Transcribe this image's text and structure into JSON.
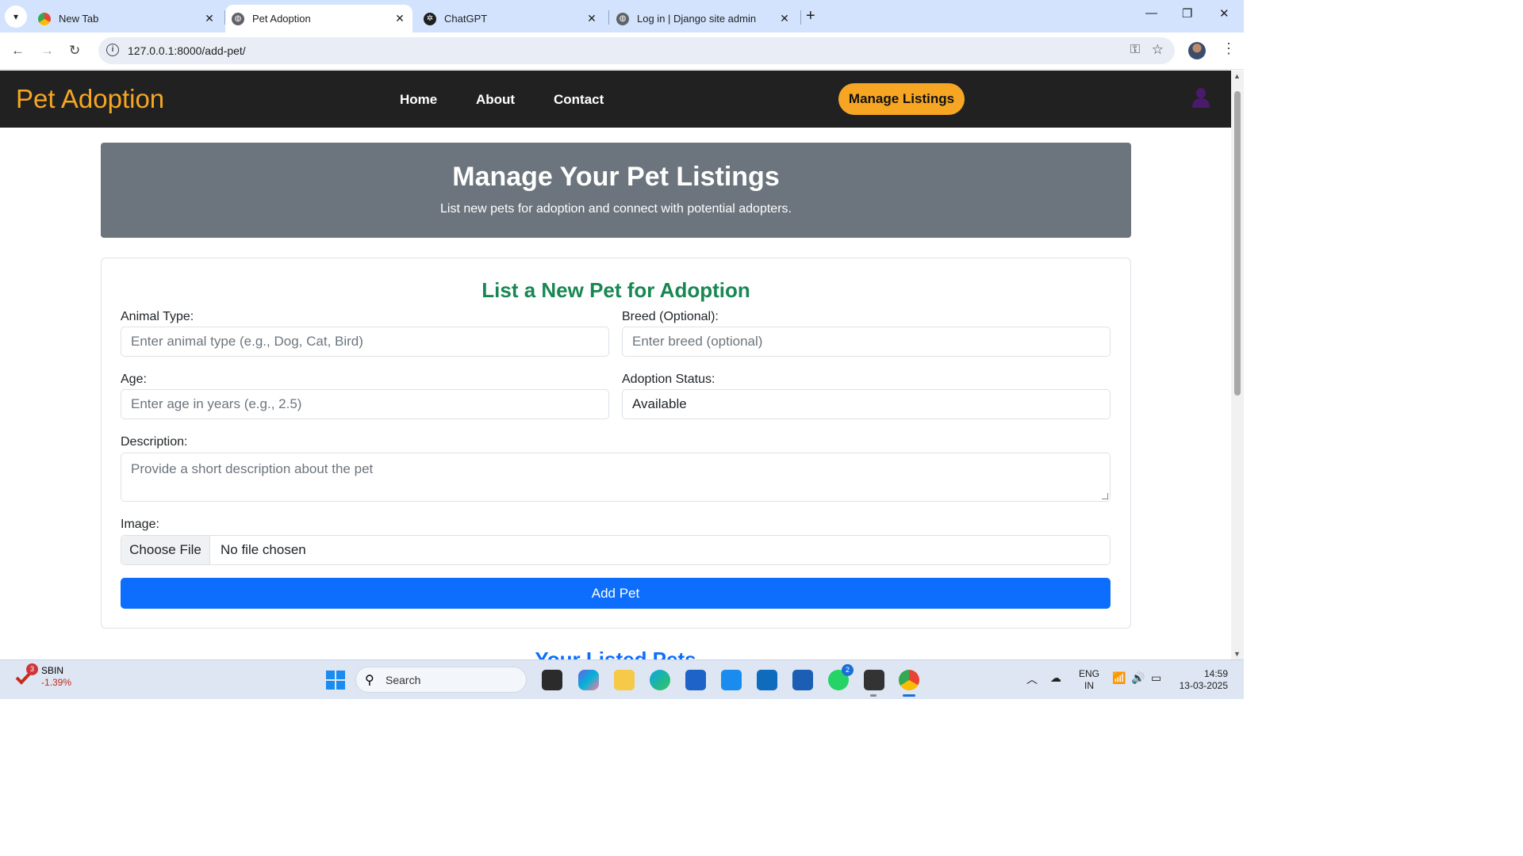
{
  "browser": {
    "tabs": [
      {
        "title": "New Tab",
        "icon": "chrome-icon",
        "active": false
      },
      {
        "title": "Pet Adoption",
        "icon": "globe-icon",
        "active": true
      },
      {
        "title": "ChatGPT",
        "icon": "chatgpt-icon",
        "active": false
      },
      {
        "title": "Log in | Django site admin",
        "icon": "globe-icon",
        "active": false
      }
    ],
    "url": "127.0.0.1:8000/add-pet/"
  },
  "site": {
    "brand": "Pet Adoption",
    "nav": {
      "home": "Home",
      "about": "About",
      "contact": "Contact"
    },
    "manage_button": "Manage Listings",
    "colors": {
      "brand": "#f5a623",
      "navbar": "#212121",
      "primary": "#0d6efd",
      "success": "#198754",
      "hero": "#6c757d"
    }
  },
  "hero": {
    "title": "Manage Your Pet Listings",
    "subtitle": "List new pets for adoption and connect with potential adopters."
  },
  "form": {
    "title": "List a New Pet for Adoption",
    "animal_type": {
      "label": "Animal Type:",
      "placeholder": "Enter animal type (e.g., Dog, Cat, Bird)"
    },
    "breed": {
      "label": "Breed (Optional):",
      "placeholder": "Enter breed (optional)"
    },
    "age": {
      "label": "Age:",
      "placeholder": "Enter age in years (e.g., 2.5)"
    },
    "status": {
      "label": "Adoption Status:",
      "value": "Available"
    },
    "description": {
      "label": "Description:",
      "placeholder": "Provide a short description about the pet"
    },
    "image": {
      "label": "Image:",
      "button": "Choose File",
      "status": "No file chosen"
    },
    "submit": "Add Pet"
  },
  "listed": {
    "title": "Your Listed Pets"
  },
  "taskbar": {
    "stock": {
      "symbol": "SBIN",
      "change": "-1.39%",
      "badge": "3"
    },
    "search": "Search",
    "whatsapp_badge": "2",
    "lang": [
      "ENG",
      "IN"
    ],
    "time": "14:59",
    "date": "13-03-2025"
  }
}
